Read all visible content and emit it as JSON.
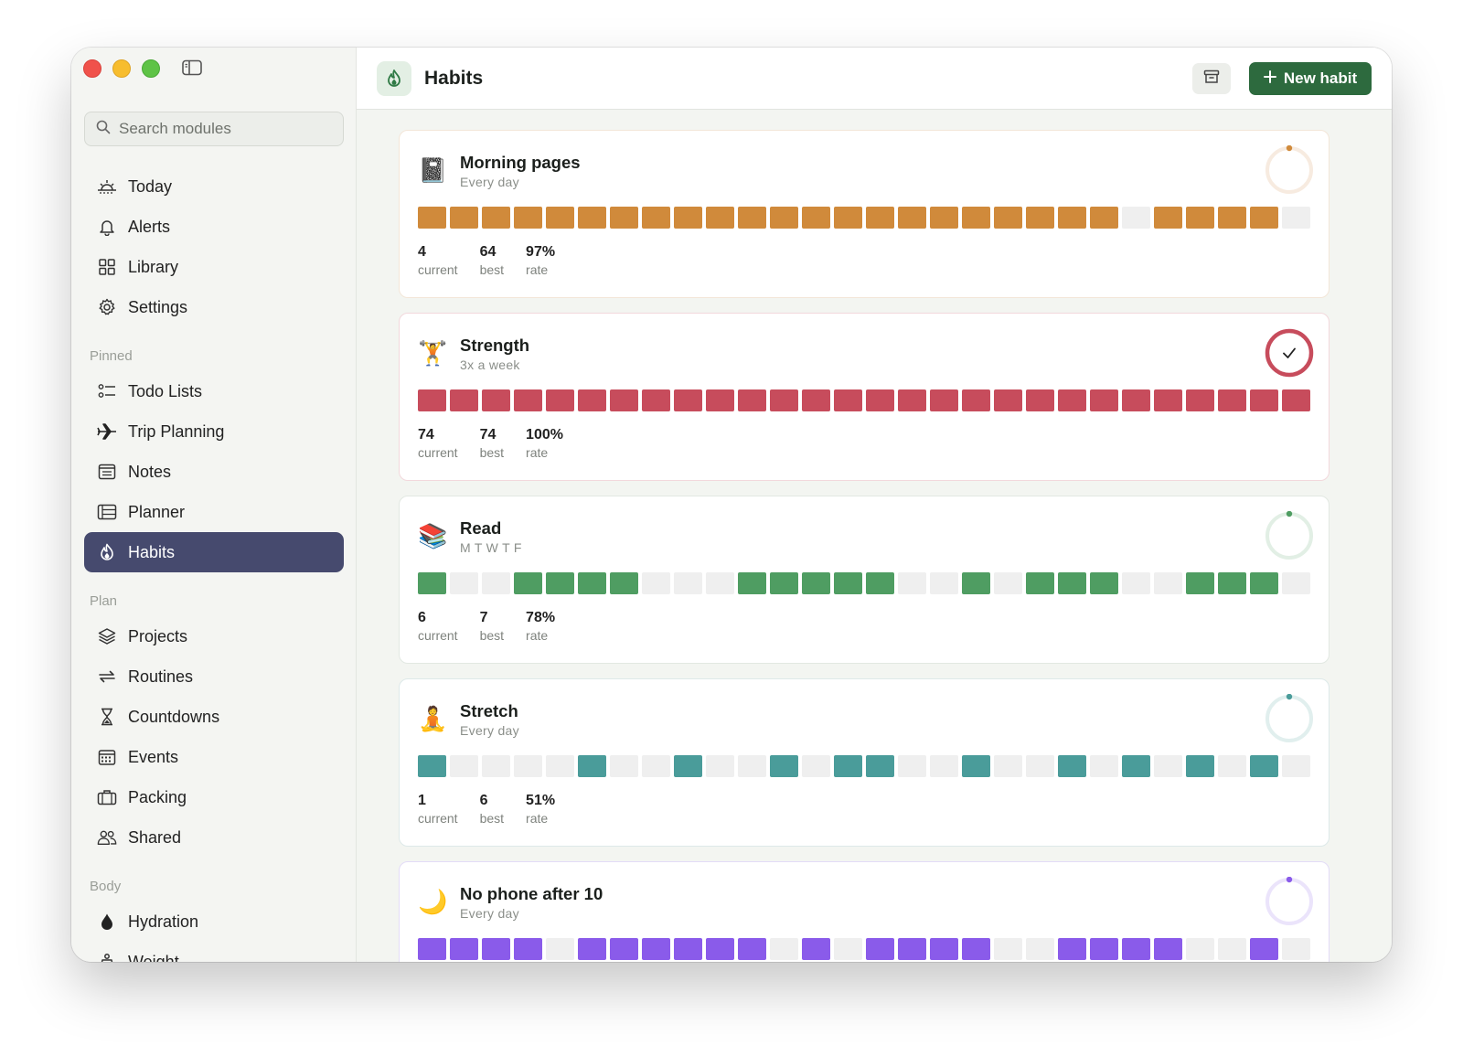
{
  "search": {
    "placeholder": "Search modules"
  },
  "sidebar": {
    "main_items": [
      {
        "label": "Today",
        "icon": "sunrise-icon"
      },
      {
        "label": "Alerts",
        "icon": "bell-icon"
      },
      {
        "label": "Library",
        "icon": "grid-icon"
      },
      {
        "label": "Settings",
        "icon": "gear-icon"
      }
    ],
    "sections": [
      {
        "label": "Pinned",
        "items": [
          {
            "label": "Todo Lists",
            "icon": "checklist-icon"
          },
          {
            "label": "Trip Planning",
            "icon": "airplane-icon"
          },
          {
            "label": "Notes",
            "icon": "notes-icon"
          },
          {
            "label": "Planner",
            "icon": "planner-icon"
          },
          {
            "label": "Habits",
            "icon": "flame-icon",
            "active": true
          }
        ]
      },
      {
        "label": "Plan",
        "items": [
          {
            "label": "Projects",
            "icon": "layers-icon"
          },
          {
            "label": "Routines",
            "icon": "repeat-icon"
          },
          {
            "label": "Countdowns",
            "icon": "hourglass-icon"
          },
          {
            "label": "Events",
            "icon": "calendar-icon"
          },
          {
            "label": "Packing",
            "icon": "suitcase-icon"
          },
          {
            "label": "Shared",
            "icon": "people-icon"
          }
        ]
      },
      {
        "label": "Body",
        "items": [
          {
            "label": "Hydration",
            "icon": "drop-icon"
          },
          {
            "label": "Weight",
            "icon": "scale-icon"
          }
        ]
      }
    ]
  },
  "header": {
    "title": "Habits",
    "new_button": "New habit",
    "icon": "flame-icon"
  },
  "colors": {
    "empty_cell": "#efefef",
    "active_nav": "#464a6e",
    "primary_button": "#2d6a3e"
  },
  "habits": [
    {
      "emoji": "📓",
      "name": "Morning pages",
      "schedule": "Every day",
      "color": "#d08a3b",
      "ring_color": "#d08a3b",
      "ring_track": "#f7ebe0",
      "border": "#f3e6d8",
      "done_today": false,
      "today_progress": 0,
      "cells": [
        1,
        1,
        1,
        1,
        1,
        1,
        1,
        1,
        1,
        1,
        1,
        1,
        1,
        1,
        1,
        1,
        1,
        1,
        1,
        1,
        1,
        1,
        0,
        1,
        1,
        1,
        1,
        0
      ],
      "stats": [
        {
          "value": "4",
          "label": "current"
        },
        {
          "value": "64",
          "label": "best"
        },
        {
          "value": "97%",
          "label": "rate"
        }
      ]
    },
    {
      "emoji": "🏋️",
      "name": "Strength",
      "schedule": "3x a week",
      "color": "#c74c5c",
      "ring_color": "#c74c5c",
      "ring_track": "#f5dde0",
      "border": "#f2d8dc",
      "done_today": true,
      "today_progress": 1,
      "cells": [
        1,
        1,
        1,
        1,
        1,
        1,
        1,
        1,
        1,
        1,
        1,
        1,
        1,
        1,
        1,
        1,
        1,
        1,
        1,
        1,
        1,
        1,
        1,
        1,
        1,
        1,
        1,
        1
      ],
      "stats": [
        {
          "value": "74",
          "label": "current"
        },
        {
          "value": "74",
          "label": "best"
        },
        {
          "value": "100%",
          "label": "rate"
        }
      ]
    },
    {
      "emoji": "📚",
      "name": "Read",
      "schedule": "M T W T F",
      "color": "#4f9d62",
      "ring_color": "#4f9d62",
      "ring_track": "#e2efe5",
      "border": "#e2e8e2",
      "done_today": false,
      "today_progress": 0,
      "cells": [
        1,
        0,
        0,
        1,
        1,
        1,
        1,
        0,
        0,
        0,
        1,
        1,
        1,
        1,
        1,
        0,
        0,
        1,
        0,
        1,
        1,
        1,
        0,
        0,
        1,
        1,
        1,
        0
      ],
      "stats": [
        {
          "value": "6",
          "label": "current"
        },
        {
          "value": "7",
          "label": "best"
        },
        {
          "value": "78%",
          "label": "rate"
        }
      ]
    },
    {
      "emoji": "🧘",
      "name": "Stretch",
      "schedule": "Every day",
      "color": "#4a9c9a",
      "ring_color": "#4a9c9a",
      "ring_track": "#e1efee",
      "border": "#dde9e9",
      "done_today": false,
      "today_progress": 0,
      "cells": [
        1,
        0,
        0,
        0,
        0,
        1,
        0,
        0,
        1,
        0,
        0,
        1,
        0,
        1,
        1,
        0,
        0,
        1,
        0,
        0,
        1,
        0,
        1,
        0,
        1,
        0,
        1,
        0
      ],
      "stats": [
        {
          "value": "1",
          "label": "current"
        },
        {
          "value": "6",
          "label": "best"
        },
        {
          "value": "51%",
          "label": "rate"
        }
      ]
    },
    {
      "emoji": "🌙",
      "name": "No phone after 10",
      "schedule": "Every day",
      "color": "#8a5bea",
      "ring_color": "#8a5bea",
      "ring_track": "#ebe4fb",
      "border": "#e3dcf7",
      "done_today": false,
      "today_progress": 0,
      "cells": [
        1,
        1,
        1,
        1,
        0,
        1,
        1,
        1,
        1,
        1,
        1,
        0,
        1,
        0,
        1,
        1,
        1,
        1,
        0,
        0,
        1,
        1,
        1,
        1,
        0,
        0,
        1,
        0
      ],
      "stats": [
        {
          "value": "",
          "label": ""
        },
        {
          "value": "",
          "label": ""
        },
        {
          "value": "",
          "label": ""
        }
      ]
    }
  ]
}
